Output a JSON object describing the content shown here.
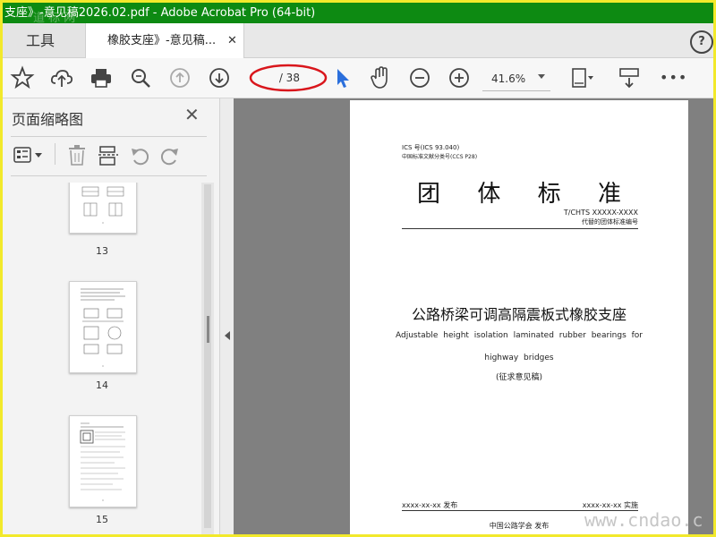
{
  "window": {
    "title": "支座》-意见稿2026.02.pdf - Adobe Acrobat Pro (64-bit)"
  },
  "tabs": {
    "tools_label": "工具",
    "document_label": "橡胶支座》-意见稿...",
    "close_glyph": "✕",
    "help_glyph": "?"
  },
  "toolbar": {
    "icons": [
      "star-icon",
      "cloud-upload-icon",
      "print-icon",
      "zoom-search-icon",
      "page-up-icon",
      "page-down-icon",
      "select-cursor-icon",
      "hand-icon",
      "zoom-out-icon",
      "zoom-in-icon",
      "page-fit-icon",
      "scroll-mode-icon",
      "more-icon"
    ],
    "page_value": "",
    "page_total": "/ 38",
    "zoom": "41.6%",
    "more": "•••"
  },
  "sidebar": {
    "title": "页面缩略图",
    "close_glyph": "✕",
    "thumbnails": [
      {
        "label": "13"
      },
      {
        "label": "14"
      },
      {
        "label": "15"
      }
    ]
  },
  "page": {
    "ics": "ICS 号(ICS 93.040)",
    "ccs": "中国标准文献分类号(CCS P28)",
    "title": "团 体 标 准",
    "code": "T/CHTS XXXXX-XXXX",
    "replaces": "代替的团体标准编号",
    "main_title": "公路桥梁可调高隔震板式橡胶支座",
    "english_line1": "Adjustable height isolation laminated rubber bearings for",
    "english_line2": "highway bridges",
    "draft": "(征求意见稿)",
    "issue_date": "xxxx-xx-xx 发布",
    "impl_date": "xxxx-xx-xx 实施",
    "org": "中国公路学会 发布"
  },
  "watermark": {
    "text": "www.cndao.c",
    "top_text": "道 标 网"
  },
  "colors": {
    "titlebar": "#0d8a12",
    "frame": "#f2e92b",
    "annotation_circle": "#d9161c",
    "cursor_blue": "#2b6fdc"
  }
}
